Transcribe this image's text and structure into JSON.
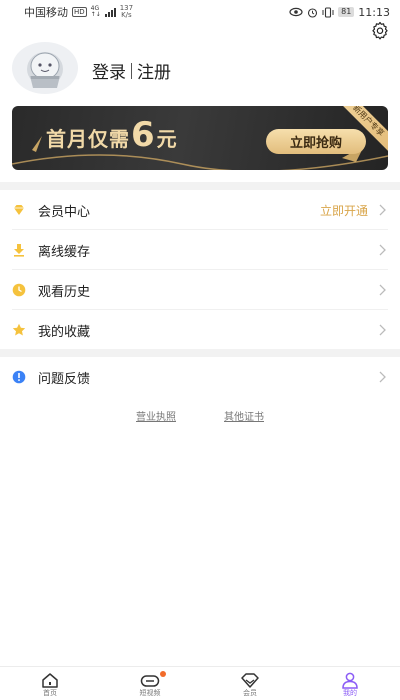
{
  "status_bar": {
    "carrier": "中国移动",
    "hd": "HD",
    "network_top": "4G",
    "network_bottom": "↑↓",
    "speed_value": "137",
    "speed_unit": "K/s",
    "battery": "81",
    "time": "11:13"
  },
  "profile": {
    "login": "登录",
    "register": "注册"
  },
  "banner": {
    "prefix": "首月仅需",
    "amount": "6",
    "suffix": "元",
    "button": "立即抢购",
    "ribbon": "新用户专享"
  },
  "menu": {
    "items": [
      {
        "label": "会员中心",
        "extra": "立即开通",
        "icon": "diamond-icon"
      },
      {
        "label": "离线缓存",
        "extra": "",
        "icon": "download-icon"
      },
      {
        "label": "观看历史",
        "extra": "",
        "icon": "clock-icon"
      },
      {
        "label": "我的收藏",
        "extra": "",
        "icon": "star-icon"
      }
    ],
    "feedback": {
      "label": "问题反馈",
      "icon": "info-icon"
    }
  },
  "links": {
    "license": "营业执照",
    "certificates": "其他证书"
  },
  "bottom_nav": [
    {
      "label": "首页",
      "icon": "home-icon"
    },
    {
      "label": "短视频",
      "icon": "link-icon"
    },
    {
      "label": "会员",
      "icon": "diamond-icon"
    },
    {
      "label": "我的",
      "icon": "person-icon"
    }
  ],
  "colors": {
    "accent_gold": "#d9a54a",
    "active_purple": "#8b5cf6",
    "badge_orange": "#f26b2a",
    "info_blue": "#3b82f6"
  }
}
